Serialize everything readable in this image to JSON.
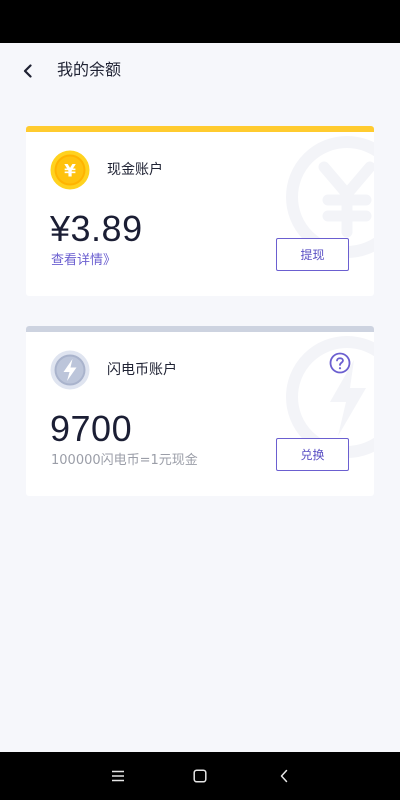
{
  "header": {
    "title": "我的余额",
    "back_icon": "chevron-left-icon"
  },
  "cash_account": {
    "title": "现金账户",
    "coin_icon": "yuan-coin-icon",
    "coin_symbol": "¥",
    "amount": "¥3.89",
    "details_link": "查看详情》",
    "action_label": "提现",
    "accent_color": "#ffcb2f"
  },
  "lightning_account": {
    "title": "闪电币账户",
    "coin_icon": "lightning-coin-icon",
    "amount": "9700",
    "rate_text": "100000闪电币=1元现金",
    "action_label": "兑换",
    "help_icon": "question-circle-icon",
    "accent_color": "#cdd3e0"
  },
  "system_nav": {
    "menu_icon": "menu-icon",
    "home_icon": "home-square-icon",
    "back_icon": "back-triangle-icon"
  },
  "colors": {
    "primary": "#6b5fd0",
    "background": "#f6f7fb"
  }
}
